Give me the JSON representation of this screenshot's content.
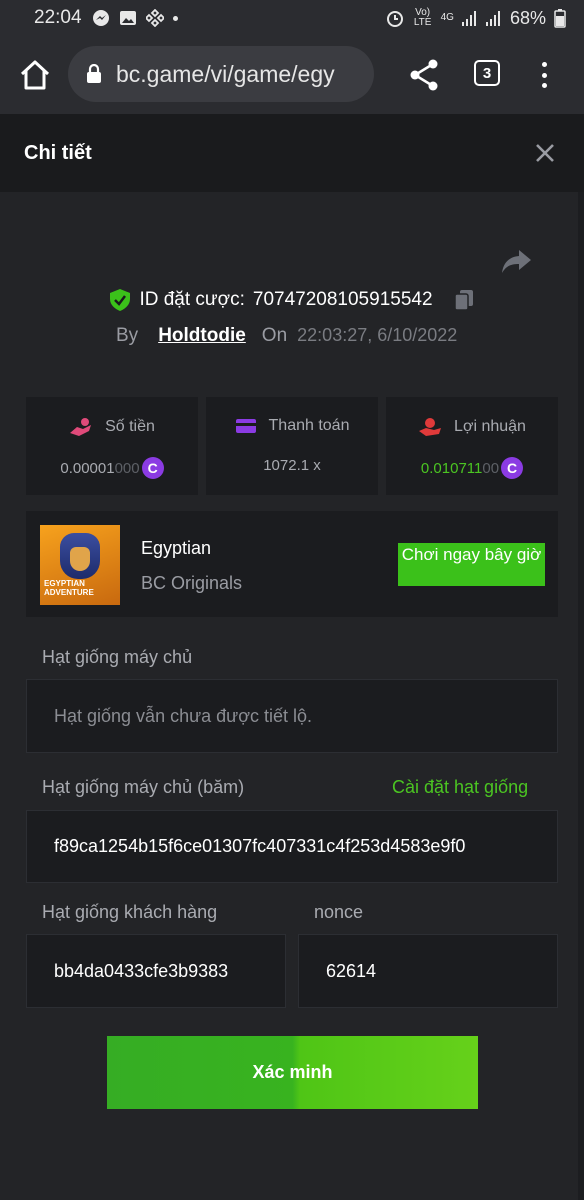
{
  "status_bar": {
    "time": "22:04",
    "volte": "Vo) LTE",
    "network": "4G",
    "battery": "68%"
  },
  "browser": {
    "url": "bc.game/vi/game/egy",
    "tab_count": "3"
  },
  "modal": {
    "title": "Chi tiết"
  },
  "bet": {
    "id_label": "ID đặt cược:",
    "id_value": "70747208105915542",
    "by_label": "By",
    "user": "Holdtodie",
    "on_label": "On",
    "datetime": "22:03:27, 6/10/2022"
  },
  "stats": {
    "amount": {
      "label": "Số tiền",
      "value_main": "0.00001",
      "value_dim": "000",
      "coin": "C"
    },
    "payout": {
      "label": "Thanh toán",
      "value": "1072.1 x"
    },
    "profit": {
      "label": "Lợi nhuận",
      "value_main": "0.010711",
      "value_dim": "00",
      "coin": "C"
    }
  },
  "game": {
    "thumb_text": "EGYPTIAN ADVENTURE",
    "name": "Egyptian",
    "provider": "BC Originals",
    "play_label": "Chơi ngay bây giờ"
  },
  "seeds": {
    "server_seed_label": "Hạt giống máy chủ",
    "server_seed_placeholder": "Hạt giống vẫn chưa được tiết lộ.",
    "server_hash_label": "Hạt giống máy chủ (băm)",
    "settings_link": "Cài đặt hạt giống",
    "server_hash_value": "f89ca1254b15f6ce01307fc407331c4f253d4583e9f0",
    "client_seed_label": "Hạt giống khách hàng",
    "client_seed_value": "bb4da0433cfe3b9383",
    "nonce_label": "nonce",
    "nonce_value": "62614"
  },
  "actions": {
    "verify_label": "Xác minh"
  },
  "colors": {
    "background": "#232427",
    "card": "#1b1c1f",
    "accent_green": "#3bc11a",
    "coin_purple": "#8b3be3"
  }
}
